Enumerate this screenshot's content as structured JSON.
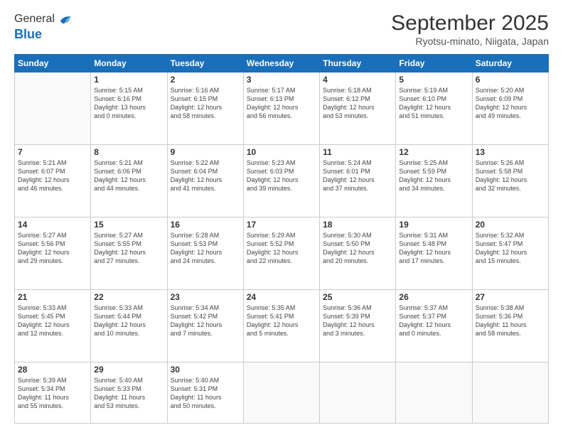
{
  "header": {
    "logo": {
      "line1": "General",
      "line2": "Blue"
    },
    "title": "September 2025",
    "location": "Ryotsu-minato, Niigata, Japan"
  },
  "weekdays": [
    "Sunday",
    "Monday",
    "Tuesday",
    "Wednesday",
    "Thursday",
    "Friday",
    "Saturday"
  ],
  "weeks": [
    [
      {
        "day": "",
        "text": ""
      },
      {
        "day": "1",
        "text": "Sunrise: 5:15 AM\nSunset: 6:16 PM\nDaylight: 13 hours\nand 0 minutes."
      },
      {
        "day": "2",
        "text": "Sunrise: 5:16 AM\nSunset: 6:15 PM\nDaylight: 12 hours\nand 58 minutes."
      },
      {
        "day": "3",
        "text": "Sunrise: 5:17 AM\nSunset: 6:13 PM\nDaylight: 12 hours\nand 56 minutes."
      },
      {
        "day": "4",
        "text": "Sunrise: 5:18 AM\nSunset: 6:12 PM\nDaylight: 12 hours\nand 53 minutes."
      },
      {
        "day": "5",
        "text": "Sunrise: 5:19 AM\nSunset: 6:10 PM\nDaylight: 12 hours\nand 51 minutes."
      },
      {
        "day": "6",
        "text": "Sunrise: 5:20 AM\nSunset: 6:09 PM\nDaylight: 12 hours\nand 49 minutes."
      }
    ],
    [
      {
        "day": "7",
        "text": "Sunrise: 5:21 AM\nSunset: 6:07 PM\nDaylight: 12 hours\nand 46 minutes."
      },
      {
        "day": "8",
        "text": "Sunrise: 5:21 AM\nSunset: 6:06 PM\nDaylight: 12 hours\nand 44 minutes."
      },
      {
        "day": "9",
        "text": "Sunrise: 5:22 AM\nSunset: 6:04 PM\nDaylight: 12 hours\nand 41 minutes."
      },
      {
        "day": "10",
        "text": "Sunrise: 5:23 AM\nSunset: 6:03 PM\nDaylight: 12 hours\nand 39 minutes."
      },
      {
        "day": "11",
        "text": "Sunrise: 5:24 AM\nSunset: 6:01 PM\nDaylight: 12 hours\nand 37 minutes."
      },
      {
        "day": "12",
        "text": "Sunrise: 5:25 AM\nSunset: 5:59 PM\nDaylight: 12 hours\nand 34 minutes."
      },
      {
        "day": "13",
        "text": "Sunrise: 5:26 AM\nSunset: 5:58 PM\nDaylight: 12 hours\nand 32 minutes."
      }
    ],
    [
      {
        "day": "14",
        "text": "Sunrise: 5:27 AM\nSunset: 5:56 PM\nDaylight: 12 hours\nand 29 minutes."
      },
      {
        "day": "15",
        "text": "Sunrise: 5:27 AM\nSunset: 5:55 PM\nDaylight: 12 hours\nand 27 minutes."
      },
      {
        "day": "16",
        "text": "Sunrise: 5:28 AM\nSunset: 5:53 PM\nDaylight: 12 hours\nand 24 minutes."
      },
      {
        "day": "17",
        "text": "Sunrise: 5:29 AM\nSunset: 5:52 PM\nDaylight: 12 hours\nand 22 minutes."
      },
      {
        "day": "18",
        "text": "Sunrise: 5:30 AM\nSunset: 5:50 PM\nDaylight: 12 hours\nand 20 minutes."
      },
      {
        "day": "19",
        "text": "Sunrise: 5:31 AM\nSunset: 5:48 PM\nDaylight: 12 hours\nand 17 minutes."
      },
      {
        "day": "20",
        "text": "Sunrise: 5:32 AM\nSunset: 5:47 PM\nDaylight: 12 hours\nand 15 minutes."
      }
    ],
    [
      {
        "day": "21",
        "text": "Sunrise: 5:33 AM\nSunset: 5:45 PM\nDaylight: 12 hours\nand 12 minutes."
      },
      {
        "day": "22",
        "text": "Sunrise: 5:33 AM\nSunset: 5:44 PM\nDaylight: 12 hours\nand 10 minutes."
      },
      {
        "day": "23",
        "text": "Sunrise: 5:34 AM\nSunset: 5:42 PM\nDaylight: 12 hours\nand 7 minutes."
      },
      {
        "day": "24",
        "text": "Sunrise: 5:35 AM\nSunset: 5:41 PM\nDaylight: 12 hours\nand 5 minutes."
      },
      {
        "day": "25",
        "text": "Sunrise: 5:36 AM\nSunset: 5:39 PM\nDaylight: 12 hours\nand 3 minutes."
      },
      {
        "day": "26",
        "text": "Sunrise: 5:37 AM\nSunset: 5:37 PM\nDaylight: 12 hours\nand 0 minutes."
      },
      {
        "day": "27",
        "text": "Sunrise: 5:38 AM\nSunset: 5:36 PM\nDaylight: 11 hours\nand 58 minutes."
      }
    ],
    [
      {
        "day": "28",
        "text": "Sunrise: 5:39 AM\nSunset: 5:34 PM\nDaylight: 11 hours\nand 55 minutes."
      },
      {
        "day": "29",
        "text": "Sunrise: 5:40 AM\nSunset: 5:33 PM\nDaylight: 11 hours\nand 53 minutes."
      },
      {
        "day": "30",
        "text": "Sunrise: 5:40 AM\nSunset: 5:31 PM\nDaylight: 11 hours\nand 50 minutes."
      },
      {
        "day": "",
        "text": ""
      },
      {
        "day": "",
        "text": ""
      },
      {
        "day": "",
        "text": ""
      },
      {
        "day": "",
        "text": ""
      }
    ]
  ]
}
